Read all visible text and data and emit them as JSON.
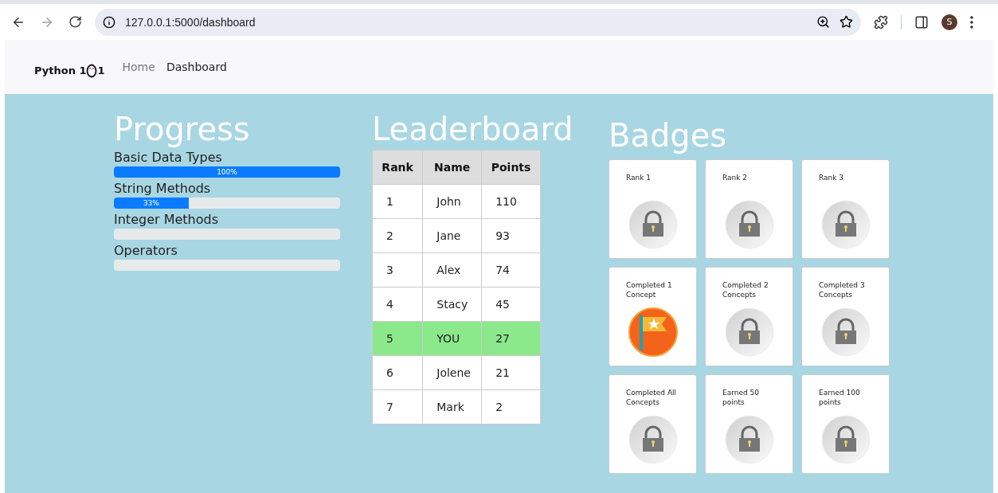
{
  "browser": {
    "url": "127.0.0.1:5000/dashboard",
    "forward_disabled": true,
    "avatar": "S"
  },
  "navbar": {
    "brand_prefix": "Python 1",
    "brand_suffix": "1",
    "links": [
      {
        "label": "Home",
        "selected": false
      },
      {
        "label": "Dashboard",
        "selected": true
      }
    ]
  },
  "progress": {
    "title": "Progress",
    "items": [
      {
        "name": "Basic Data Types",
        "level": 1,
        "reading": "100%"
      },
      {
        "name": "String Methods",
        "level": 0.33,
        "reading": "33%"
      },
      {
        "name": "Integer Methods"
      },
      {
        "name": "Operators"
      }
    ]
  },
  "leaderboard": {
    "title": "Leaderboard",
    "columns": [
      "Rank",
      "Name",
      "Points"
    ],
    "rows": [
      {
        "cells": [
          "1",
          "John",
          "110"
        ],
        "selected": false
      },
      {
        "cells": [
          "2",
          "Jane",
          "93"
        ],
        "selected": false
      },
      {
        "cells": [
          "3",
          "Alex",
          "74"
        ],
        "selected": false
      },
      {
        "cells": [
          "4",
          "Stacy",
          "45"
        ],
        "selected": false
      },
      {
        "cells": [
          "5",
          "YOU",
          "27"
        ],
        "selected": true
      },
      {
        "cells": [
          "6",
          "Jolene",
          "21"
        ],
        "selected": false
      },
      {
        "cells": [
          "7",
          "Mark",
          "2"
        ],
        "selected": false
      }
    ]
  },
  "badges": {
    "title": "Badges",
    "items": [
      {
        "label": "Rank 1",
        "earned": false
      },
      {
        "label": "Rank 2",
        "earned": false
      },
      {
        "label": "Rank 3",
        "earned": false
      },
      {
        "label": "Completed 1 Concept",
        "earned": true
      },
      {
        "label": "Completed 2 Concepts",
        "earned": false
      },
      {
        "label": "Completed 3 Concepts",
        "earned": false
      },
      {
        "label": "Completed All Concepts",
        "earned": false
      },
      {
        "label": "Earned 50 points",
        "earned": false
      },
      {
        "label": "Earned 100 points",
        "earned": false
      }
    ]
  }
}
